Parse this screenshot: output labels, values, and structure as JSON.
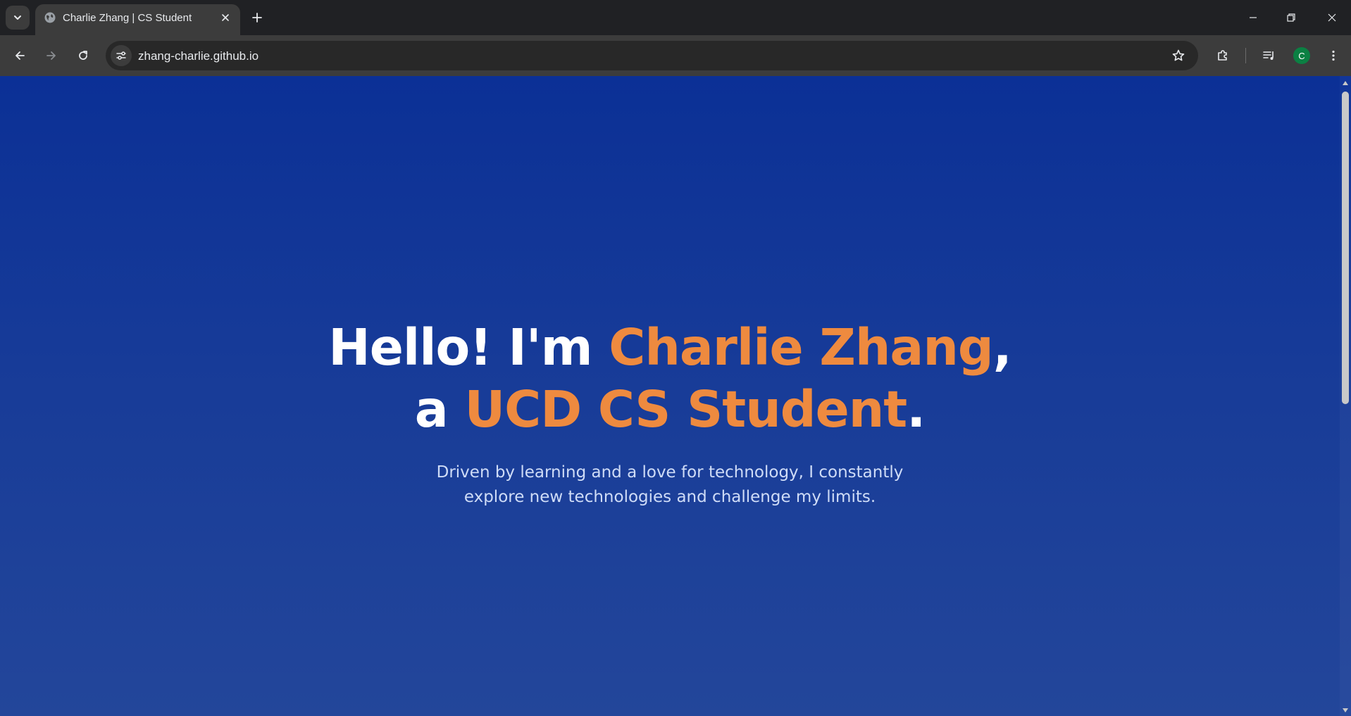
{
  "browser": {
    "tab_title": "Charlie Zhang | CS Student",
    "url": "zhang-charlie.github.io",
    "profile_initial": "C",
    "icons": {
      "tab_search": "chevron-down-icon",
      "favicon": "globe-icon",
      "tab_close": "close-icon",
      "new_tab": "plus-icon",
      "minimize": "minimize-icon",
      "restore": "restore-icon",
      "close_window": "close-icon",
      "back": "arrow-left-icon",
      "forward": "arrow-right-icon",
      "reload": "reload-icon",
      "site_info": "tune-icon",
      "bookmark": "star-icon",
      "extensions": "puzzle-icon",
      "reading_list": "playlist-icon",
      "menu": "kebab-icon"
    },
    "colors": {
      "frame": "#202124",
      "toolbar": "#3c3c3c",
      "avatar": "#0b8043"
    }
  },
  "hero": {
    "line1_prefix": "Hello! I'm ",
    "line1_name": "Charlie Zhang",
    "line1_suffix": ",",
    "line2_prefix": "a ",
    "line2_role": "UCD CS Student",
    "line2_suffix": ".",
    "subtitle_line1": "Driven by learning and a love for technology, I constantly",
    "subtitle_line2": "explore new technologies and challenge my limits.",
    "colors": {
      "heading": "#ffffff",
      "accent": "#ee8a3f",
      "subtitle": "#cfdcf7",
      "gradient_top": "#0b3096",
      "gradient_bottom": "#23469a"
    }
  }
}
